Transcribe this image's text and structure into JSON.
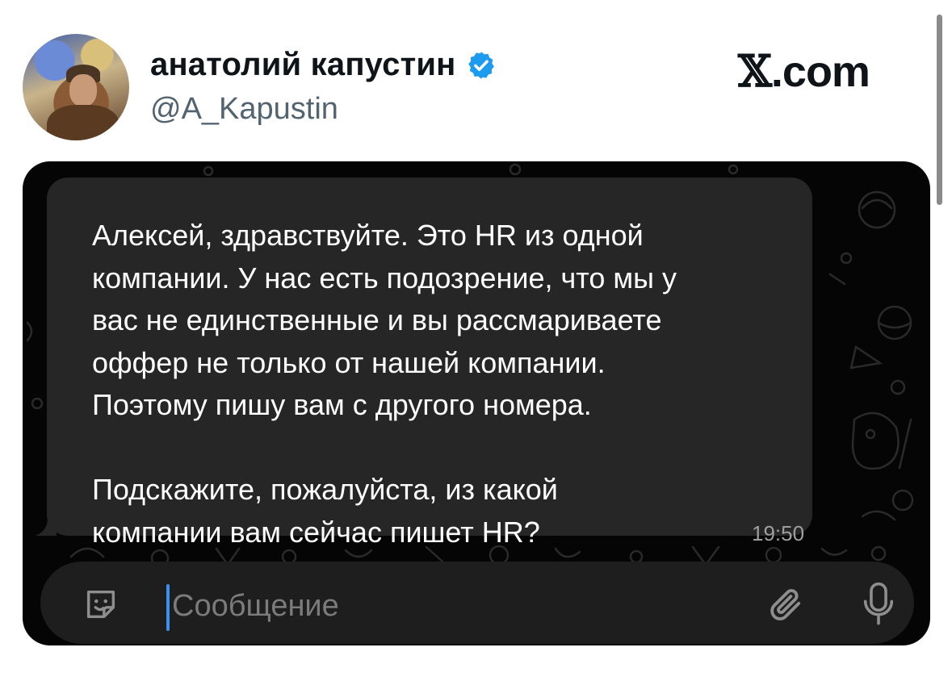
{
  "tweet": {
    "display_name": "анатолий капустин",
    "handle": "@A_Kapustin",
    "source_logo": ".com",
    "verified": true
  },
  "chat": {
    "message_text": "Алексей, здравствуйте. Это HR из одной\nкомпании. У нас есть подозрение, что мы у\nвас не единственные и вы рассмариваете\nоффер не только от нашей компании.\nПоэтому пишу вам с другого номера.\n\nПодскажите, пожалуйста, из какой\nкомпании вам сейчас пишет HR?",
    "time": "19:50",
    "input_placeholder": "Сообщение"
  },
  "icons": {
    "verified": "verified-badge-icon",
    "sticker": "sticker-icon",
    "attach": "paperclip-icon",
    "mic": "microphone-icon"
  },
  "colors": {
    "verified_blue": "#1d9bf0",
    "chat_background": "#050505",
    "bubble": "#262626",
    "input_bar": "#1e1e1e",
    "cursor": "#3f8ef0"
  }
}
